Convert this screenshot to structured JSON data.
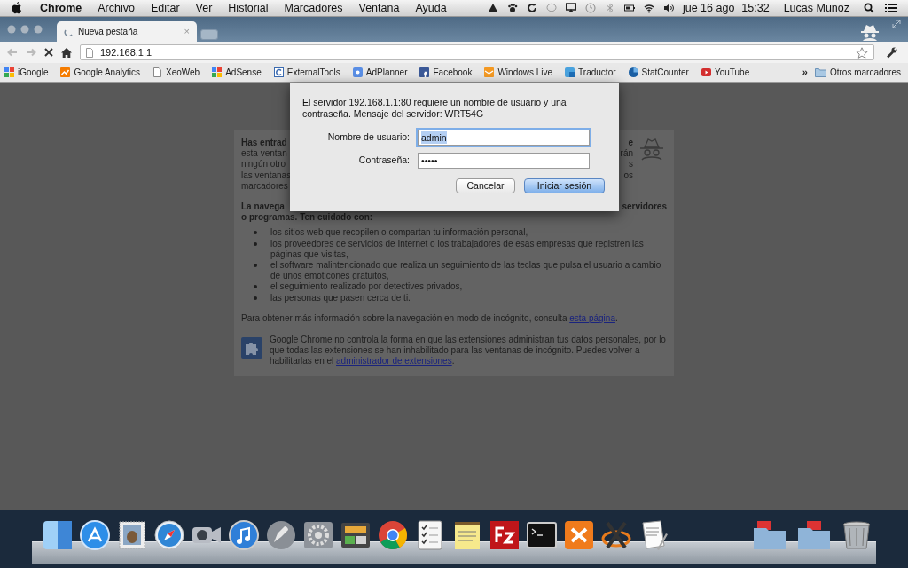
{
  "menu_bar": {
    "app": "Chrome",
    "items": [
      "Archivo",
      "Editar",
      "Ver",
      "Historial",
      "Marcadores",
      "Ventana",
      "Ayuda"
    ],
    "date": "jue 16 ago",
    "time": "15:32",
    "user": "Lucas Muñoz"
  },
  "tabs": [
    {
      "title": "Nueva pestaña",
      "close": "×",
      "selected": true
    }
  ],
  "address_bar": {
    "url": "192.168.1.1"
  },
  "bookmarks": [
    {
      "label": "iGoogle"
    },
    {
      "label": "Google Analytics"
    },
    {
      "label": "XeoWeb"
    },
    {
      "label": "AdSense"
    },
    {
      "label": "ExternalTools"
    },
    {
      "label": "AdPlanner"
    },
    {
      "label": "Facebook"
    },
    {
      "label": "Windows Live"
    },
    {
      "label": "Traductor"
    },
    {
      "label": "StatCounter"
    },
    {
      "label": "YouTube"
    }
  ],
  "bookmarks_overflow": "»",
  "other_bookmarks": "Otros marcadores",
  "incognito_page": {
    "covered_lines": [
      {
        "left": "Has entrad",
        "right": "e",
        "bold": true
      },
      {
        "left": "esta ventan",
        "right": "rán",
        "bold": false
      },
      {
        "left": "ningún otro",
        "right": "s",
        "bold": false
      },
      {
        "left": "las ventanas",
        "right": "os",
        "bold": false
      },
      {
        "left": "marcadores",
        "bold": false
      }
    ],
    "warning_line": {
      "left": "La navega",
      "right": "servidores"
    },
    "warning_tail": "o programas. Ten cuidado con:",
    "list": [
      "los sitios web que recopilen o compartan tu información personal,",
      "los proveedores de servicios de Internet o los trabajadores de esas empresas que registren las páginas que visitas,",
      "el software malintencionado que realiza un seguimiento de las teclas que pulsa el usuario a cambio de unos emoticones gratuitos,",
      "el seguimiento realizado por detectives privados,",
      "las personas que pasen cerca de ti."
    ],
    "more_info": {
      "text": "Para obtener más información sobre la navegación en modo de incógnito, consulta ",
      "link": "esta página",
      "end": "."
    },
    "extensions_note": {
      "text": "Google Chrome no controla la forma en que las extensiones administran tus datos personales, por lo que todas las extensiones se han inhabilitado para las ventanas de incógnito. Puedes volver a habilitarlas en el ",
      "link": "administrador de extensiones",
      "end": "."
    }
  },
  "auth_dialog": {
    "message": "El servidor 192.168.1.1:80 requiere un nombre de usuario y una contraseña. Mensaje del servidor: WRT54G",
    "username_label": "Nombre de usuario:",
    "username": "admin",
    "username_text_selected": true,
    "password_label": "Contraseña:",
    "password": "•••••",
    "buttons": [
      {
        "label": "Cancelar",
        "kind": "cancel"
      },
      {
        "label": "Iniciar sesión",
        "kind": "default"
      }
    ]
  }
}
